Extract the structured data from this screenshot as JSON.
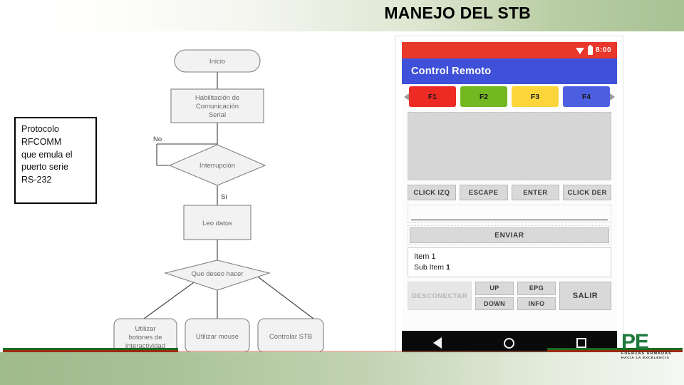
{
  "slide": {
    "title": "MANEJO DEL STB"
  },
  "note": {
    "lines": [
      "Protocolo",
      "RFCOMM",
      "que emula el",
      "puerto serie",
      "RS-232"
    ]
  },
  "flowchart": {
    "nodes": [
      {
        "id": "inicio",
        "label": "Inicio",
        "shape": "terminator"
      },
      {
        "id": "habilitacion",
        "label_1": "Habilitación de",
        "label_2": "Comunicación",
        "label_3": "Serial",
        "shape": "process"
      },
      {
        "id": "interrupcion",
        "label": "Interrupción",
        "shape": "decision"
      },
      {
        "id": "leo_datos",
        "label": "Leo datos",
        "shape": "process"
      },
      {
        "id": "que_deseo",
        "label": "Que deseo hacer",
        "shape": "decision"
      },
      {
        "id": "botones",
        "label_1": "Utilizar",
        "label_2": "botones de",
        "label_3": "interactividad",
        "shape": "terminator"
      },
      {
        "id": "mouse",
        "label": "Utilizar mouse",
        "shape": "terminator"
      },
      {
        "id": "stb",
        "label": "Controlar STB",
        "shape": "terminator"
      }
    ],
    "edge_labels": {
      "no": "No",
      "si": "Si"
    }
  },
  "phone": {
    "status_bar": {
      "time": "8:00",
      "wifi_icon": "wifi-icon",
      "battery_icon": "battery-icon",
      "color": "#e8372b"
    },
    "app_bar": {
      "title": "Control Remoto",
      "color": "#3f51d8"
    },
    "function_keys": [
      {
        "label": "F1",
        "color": "#ee2a24"
      },
      {
        "label": "F2",
        "color": "#74b821"
      },
      {
        "label": "F3",
        "color": "#fbd53a"
      },
      {
        "label": "F4",
        "color": "#4c5fe0"
      }
    ],
    "action_buttons": [
      "CLICK IZQ",
      "ESCAPE",
      "ENTER",
      "CLICK DER"
    ],
    "send_button": "ENVIAR",
    "list_item": {
      "title": "Item 1",
      "subtitle_prefix": "Sub Item ",
      "subtitle_bold": "1"
    },
    "bottom_buttons": {
      "disconnect": "DESCONECTAR",
      "up": "UP",
      "down": "DOWN",
      "epg": "EPG",
      "info": "INFO",
      "exit": "SALIR"
    },
    "nav_bar": {
      "back_icon": "back-triangle-icon",
      "home_icon": "home-circle-icon",
      "recents_icon": "recents-square-icon"
    }
  },
  "logo": {
    "mark": "PE",
    "line1": "FUERZAS ARMADAS",
    "line2": "HACIA LA EXCELENCIA"
  }
}
